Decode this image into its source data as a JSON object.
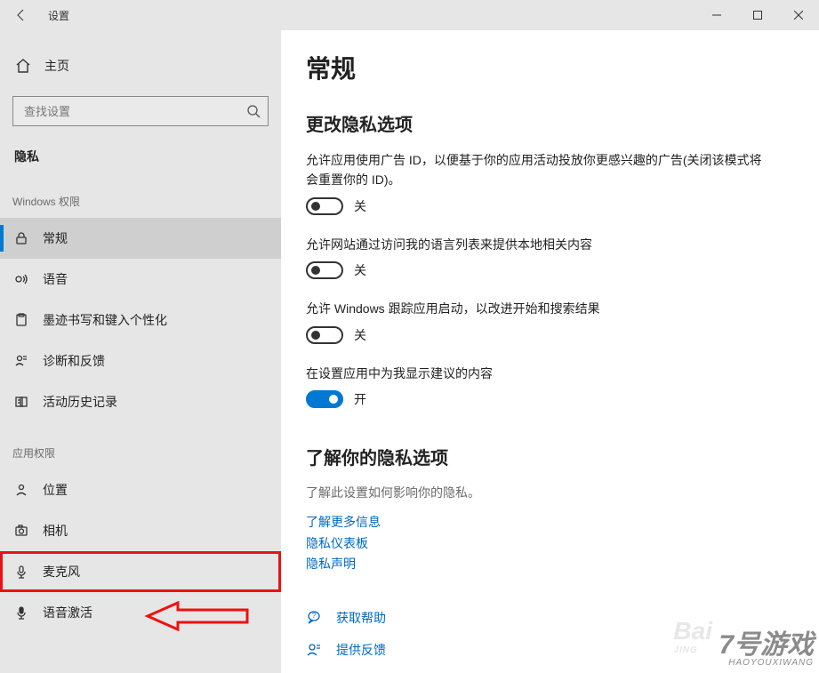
{
  "window": {
    "title": "设置"
  },
  "sidebar": {
    "home_label": "主页",
    "search_placeholder": "查找设置",
    "category_label": "隐私",
    "section1_label": "Windows 权限",
    "section2_label": "应用权限",
    "win_perms": [
      {
        "label": "常规",
        "icon": "lock"
      },
      {
        "label": "语音",
        "icon": "speech"
      },
      {
        "label": "墨迹书写和键入个性化",
        "icon": "clipboard"
      },
      {
        "label": "诊断和反馈",
        "icon": "feedback"
      },
      {
        "label": "活动历史记录",
        "icon": "history"
      }
    ],
    "app_perms": [
      {
        "label": "位置",
        "icon": "location"
      },
      {
        "label": "相机",
        "icon": "camera"
      },
      {
        "label": "麦克风",
        "icon": "mic"
      },
      {
        "label": "语音激活",
        "icon": "voice"
      }
    ]
  },
  "content": {
    "page_title": "常规",
    "section1_title": "更改隐私选项",
    "options": [
      {
        "desc": "允许应用使用广告 ID，以便基于你的应用活动投放你更感兴趣的广告(关闭该模式将会重置你的 ID)。",
        "state": "off",
        "state_label": "关"
      },
      {
        "desc": "允许网站通过访问我的语言列表来提供本地相关内容",
        "state": "off",
        "state_label": "关"
      },
      {
        "desc": "允许 Windows 跟踪应用启动，以改进开始和搜索结果",
        "state": "off",
        "state_label": "关"
      },
      {
        "desc": "在设置应用中为我显示建议的内容",
        "state": "on",
        "state_label": "开"
      }
    ],
    "learn_title": "了解你的隐私选项",
    "learn_desc": "了解此设置如何影响你的隐私。",
    "links": [
      "了解更多信息",
      "隐私仪表板",
      "隐私声明"
    ],
    "help_links": [
      {
        "label": "获取帮助",
        "icon": "help"
      },
      {
        "label": "提供反馈",
        "icon": "feedback"
      }
    ]
  },
  "watermark": {
    "line1": "7号游戏",
    "sub": "HAOYOUXIWANG"
  },
  "watermark2": {
    "line1": "Bai",
    "sub": "JING"
  }
}
